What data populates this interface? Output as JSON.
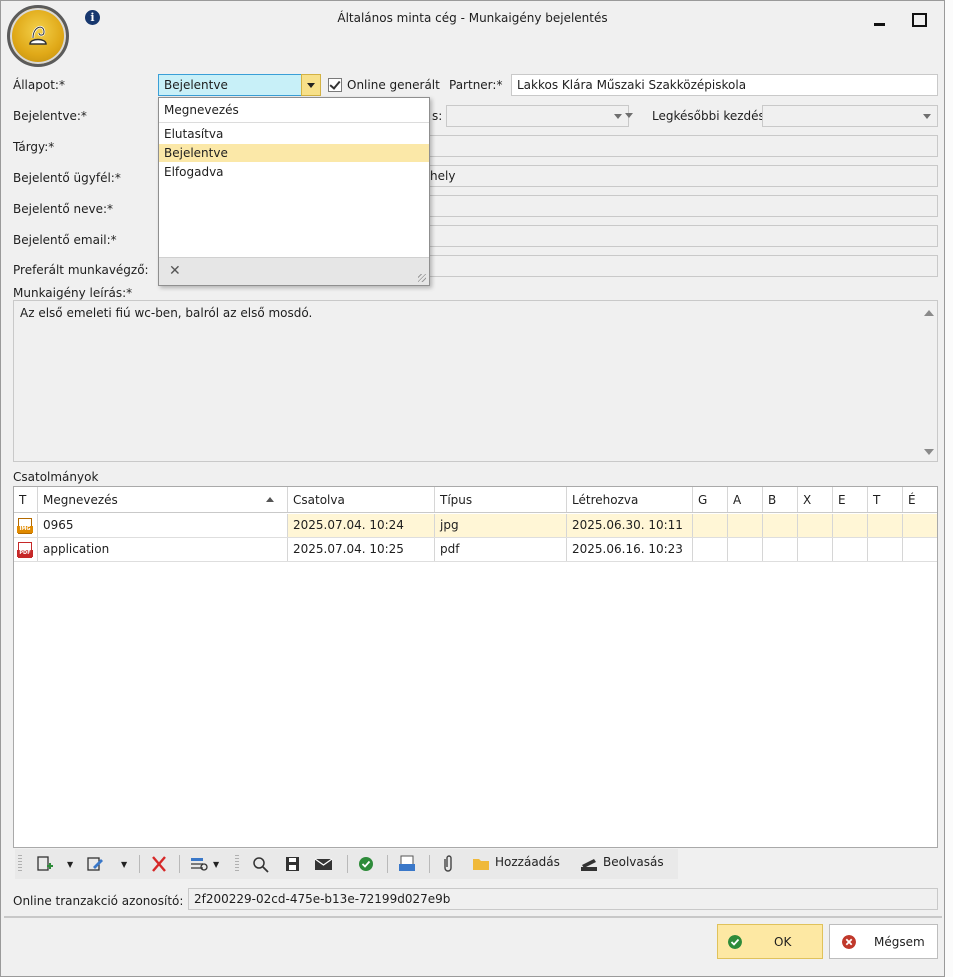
{
  "window": {
    "title": "Általános minta cég - Munkaigény bejelentés"
  },
  "form": {
    "allapot_label": "Állapot:*",
    "allapot_value": "Bejelentve",
    "online_generalt_label": "Online generált",
    "online_generalt_checked": true,
    "partner_label": "Partner:*",
    "partner_value": "Lakkos Klára Műszaki Szakközépiskola",
    "bejelentve_label": "Bejelentve:*",
    "hatarido_label_fragment": "s:",
    "legkesobbi_label": "Legkésőbbi kezdés:",
    "targy_label": "Tárgy:*",
    "ugyfel_label": "Bejelentő ügyfél:*",
    "ugyfel_value_fragment": "hely",
    "nev_label": "Bejelentő neve:*",
    "email_label": "Bejelentő email:*",
    "munkavegzo_label": "Preferált munkavégző:",
    "leiras_label": "Munkaigény leírás:*",
    "leiras_value": "Az első emeleti fiú wc-ben, balról az első mosdó."
  },
  "dropdown": {
    "header": "Megnevezés",
    "items": [
      "Elutasítva",
      "Bejelentve",
      "Elfogadva"
    ],
    "selected_index": 1
  },
  "attachments": {
    "label": "Csatolmányok",
    "columns": [
      "T",
      "Megnevezés",
      "Csatolva",
      "Típus",
      "Létrehozva",
      "G",
      "A",
      "B",
      "X",
      "E",
      "T",
      "É"
    ],
    "rows": [
      {
        "icon": "image-file-icon",
        "icon_tag": "IMG",
        "name": "0965",
        "attached": "2025.07.04. 10:24",
        "type": "jpg",
        "created": "2025.06.30. 10:11"
      },
      {
        "icon": "pdf-file-icon",
        "icon_tag": "PDF",
        "name": "application",
        "attached": "2025.07.04. 10:25",
        "type": "pdf",
        "created": "2025.06.16. 10:23"
      }
    ]
  },
  "toolbar": {
    "add_label": "Hozzáadás",
    "scan_label": "Beolvasás"
  },
  "footer": {
    "tranz_label": "Online tranzakció azonosító:",
    "tranz_value": "2f200229-02cd-475e-b13e-72199d027e9b",
    "ok_label": "OK",
    "cancel_label": "Mégsem"
  },
  "colors": {
    "accent_blue": "#3a9fd7",
    "status_fill": "#c8f0f8",
    "highlight_yellow": "#fbe8a8",
    "ok_green": "#2e8b3a",
    "cancel_red": "#c0392b",
    "delete_red": "#d62828"
  }
}
